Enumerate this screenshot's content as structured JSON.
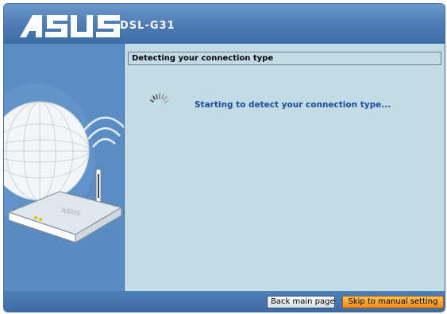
{
  "header": {
    "logo_text": "ASUS",
    "model": "DSL-G31"
  },
  "main": {
    "section_title": "Detecting your connection type",
    "status_text": "Starting to detect your connection type...",
    "spinner_icon": "loading-spinner-icon"
  },
  "sidebar": {
    "illustration": "router-globe-illustration",
    "router_label": "ASUS"
  },
  "footer": {
    "back_label": "Back main page",
    "skip_label": "Skip to manual setting"
  },
  "colors": {
    "header_blue": "#4a79b2",
    "content_bg": "#c2dbe6",
    "status_text": "#1f4a9b",
    "skip_button": "#f08a1c"
  }
}
